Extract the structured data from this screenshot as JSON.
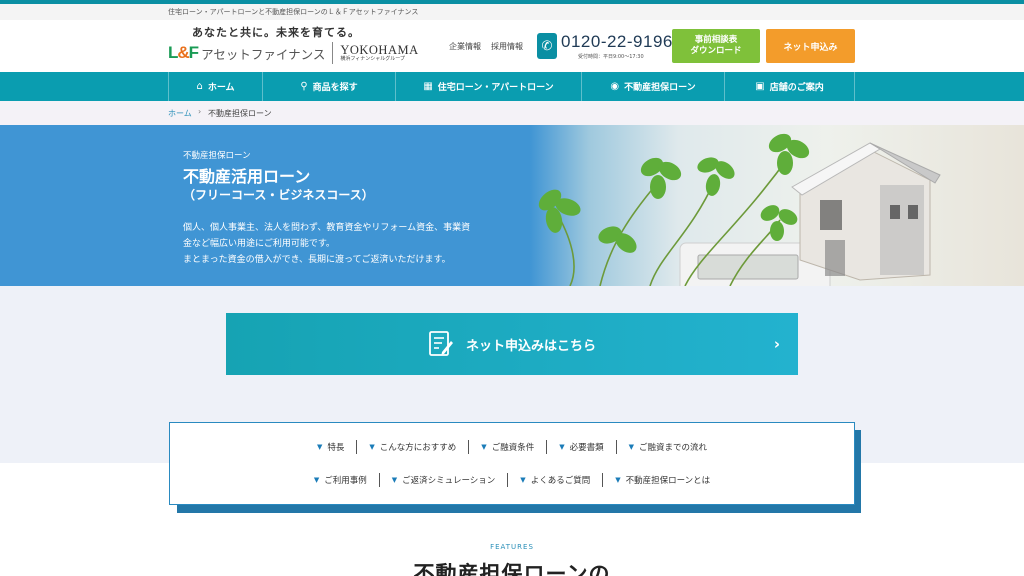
{
  "topbar": {
    "text": "住宅ローン・アパートローンと不動産担保ローンのＬ＆Ｆアセットファイナンス"
  },
  "brand": {
    "tagline": "あなたと共に。未来を育てる。",
    "logo_mark": "L&F",
    "logo_name": "アセットファイナンス",
    "partner_name": "YOKOHAMA",
    "partner_sub": "横浜フィナンシャルグループ"
  },
  "header": {
    "links": [
      "企業情報",
      "採用情報"
    ],
    "phone": "0120-22-9196",
    "phone_hours": "受付時間：平日9:00～17:30",
    "btn_download_line1": "事前相談表",
    "btn_download_line2": "ダウンロード",
    "btn_apply": "ネット申込み"
  },
  "nav": {
    "items": [
      {
        "label": "ホーム",
        "icon": "home-icon"
      },
      {
        "label": "商品を探す",
        "icon": "search-icon"
      },
      {
        "label": "住宅ローン・アパートローン",
        "icon": "building-icon"
      },
      {
        "label": "不動産担保ローン",
        "icon": "money-bag-icon"
      },
      {
        "label": "店舗のご案内",
        "icon": "store-icon"
      }
    ]
  },
  "breadcrumb": {
    "home": "ホーム",
    "current": "不動産担保ローン"
  },
  "hero": {
    "category": "不動産担保ローン",
    "title": "不動産活用ローン",
    "subtitle": "（フリーコース・ビジネスコース）",
    "desc_line1": "個人、個人事業主、法人を問わず、教育資金やリフォーム資金、事業資",
    "desc_line2": "金など幅広い用途にご利用可能です。",
    "desc_line3": "まとまった資金の借入ができ、長期に渡ってご返済いただけます。"
  },
  "apply": {
    "label": "ネット申込みはこちら"
  },
  "anchors": {
    "row1": [
      "特長",
      "こんな方におすすめ",
      "ご融資条件",
      "必要書類",
      "ご融資までの流れ"
    ],
    "row2": [
      "ご利用事例",
      "ご返済シミュレーション",
      "よくあるご質問",
      "不動産担保ローンとは"
    ]
  },
  "features": {
    "eyebrow": "FEATURES",
    "title": "不動産担保ローンの"
  },
  "colors": {
    "teal": "#0a9db0",
    "green": "#7fc13a",
    "orange": "#f39c2b",
    "hero_blue": "#4095d4"
  }
}
